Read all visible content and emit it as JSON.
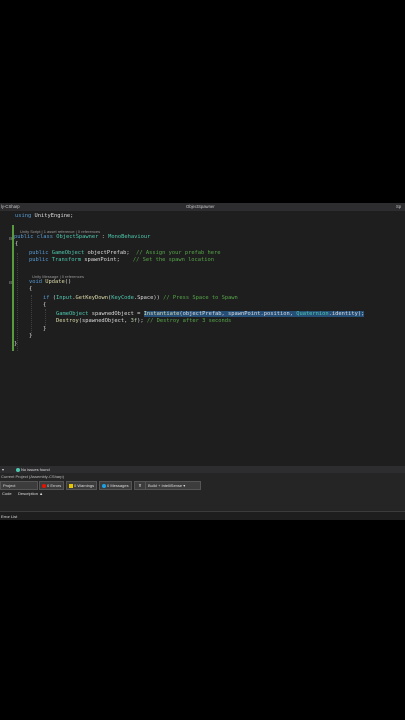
{
  "window": {
    "left_tab": "ly-CSharp",
    "center_tab": "ObjectSpawner",
    "right_tab": "Sp"
  },
  "code": {
    "line1_kw": "using",
    "line1_rest": " UnityEngine;",
    "hint1": "Unity Script | 1 asset reference | 0 references",
    "line_class_kw1": "public",
    "line_class_kw2": "class",
    "line_class_name": "ObjectSpawner",
    "line_class_colon": " : ",
    "line_class_base": "MonoBehaviour",
    "brace_open": "{",
    "field1_kw": "public",
    "field1_type": "GameObject",
    "field1_name": " objectPrefab;",
    "field1_comment": "// Assign your prefab here",
    "field2_kw": "public",
    "field2_type": "Transform",
    "field2_name": " spawnPoint;",
    "field2_comment": "// Set the spawn location",
    "hint2": "Unity Message | 0 references",
    "method_kw": "void",
    "method_name": "Update",
    "method_parens": "()",
    "if_kw": "if",
    "if_open": " (",
    "if_input": "Input",
    "if_dot": ".",
    "if_fn": "GetKeyDown",
    "if_args_open": "(",
    "if_keycode": "KeyCode",
    "if_space": ".Space",
    "if_close": "))",
    "if_comment": "// Press Space to Spawn",
    "inst_type": "GameObject",
    "inst_var": " spawnedObject = ",
    "inst_fn": "Instantiate",
    "inst_args": "(objectPrefab, spawnPoint.position, ",
    "inst_quat": "Quaternion",
    "inst_ident": ".identity);",
    "destroy_fn": "Destroy",
    "destroy_args_a": "(spawnedObject, ",
    "destroy_num": "3f",
    "destroy_args_b": ");",
    "destroy_comment": "// Destroy after 3 seconds",
    "brace_close_inner": "}",
    "brace_close_method": "}",
    "brace_close_class": "}"
  },
  "status": {
    "issues": "No issues found"
  },
  "panel": {
    "scope": "Current Project (Assembly-CSharp)",
    "project_label": "Project",
    "errors": "0 Errors",
    "warnings": "0 Warnings",
    "messages": "0 Messages",
    "build_filter": "Build + IntelliSense",
    "col_code": "Code",
    "col_description": "Description"
  },
  "bottom": {
    "tab": "Error List"
  },
  "colors": {
    "editor_bg": "#1e1e1e",
    "keyword": "#569cd6",
    "type": "#4ec9b0",
    "comment": "#57a64a",
    "selection": "#264f78",
    "change_bar": "#5a9a3e"
  }
}
